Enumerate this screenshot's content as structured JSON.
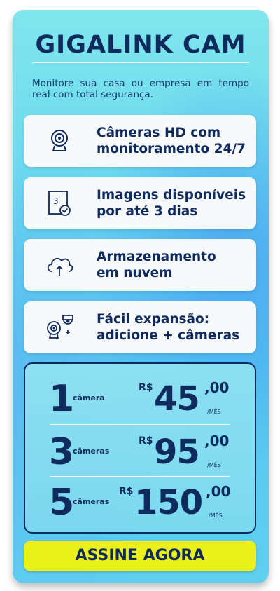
{
  "header": {
    "title": "GIGALINK CAM",
    "subtitle": "Monitore sua casa ou empresa em tempo real com total segurança."
  },
  "features": [
    {
      "icon": "webcam-icon",
      "line1": "Câmeras HD com",
      "line2": "monitoramento 24/7"
    },
    {
      "icon": "calendar-3-days-icon",
      "line1": "Imagens disponíveis",
      "line2": "por até 3 dias"
    },
    {
      "icon": "cloud-upload-icon",
      "line1": "Armazenamento",
      "line2": "em nuvem"
    },
    {
      "icon": "add-cameras-icon",
      "line1": "Fácil expansão:",
      "line2": "adicione + câmeras"
    }
  ],
  "pricing": [
    {
      "qty": "1",
      "unit": "câmera",
      "currency": "R$",
      "amount": "45",
      "cents": ",00",
      "period": "/MÊS"
    },
    {
      "qty": "3",
      "unit": "câmeras",
      "currency": "R$",
      "amount": "95",
      "cents": ",00",
      "period": "/MÊS"
    },
    {
      "qty": "5",
      "unit": "câmeras",
      "currency": "R$",
      "amount": "150",
      "cents": ",00",
      "period": "/MÊS"
    }
  ],
  "cta": {
    "label": "ASSINE AGORA"
  },
  "colors": {
    "navy": "#0f2a5c",
    "cta": "#eaf01a"
  }
}
